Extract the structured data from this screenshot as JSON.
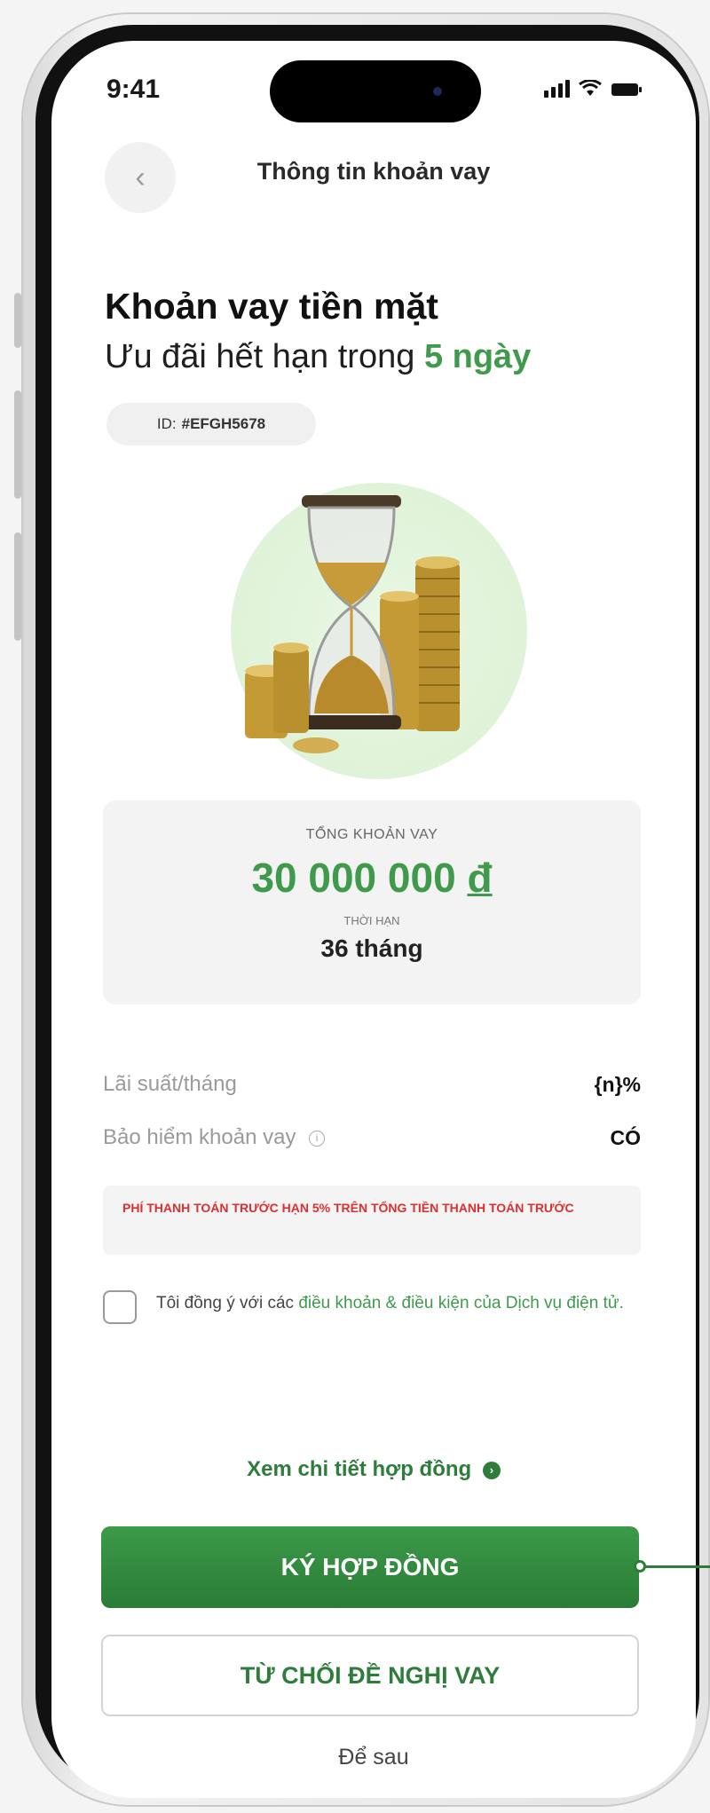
{
  "status_bar": {
    "time": "9:41",
    "icons": [
      "signal-icon",
      "wifi-icon",
      "battery-icon"
    ]
  },
  "header": {
    "back_icon": "chevron-left-icon",
    "title": "Thông tin khoản vay"
  },
  "hero": {
    "title": "Khoản vay tiền mặt",
    "subtitle_prefix": "Ưu đãi hết hạn trong",
    "subtitle_highlight": "5 ngày",
    "id_label": "ID:",
    "id_value": "#EFGH5678",
    "illustration": "hourglass-coins-illustration"
  },
  "loan_summary": {
    "total_label": "TỔNG KHOẢN VAY",
    "total_amount": "30 000 000",
    "currency": "đ",
    "term_label": "THỜI HẠN",
    "term_value": "36 tháng"
  },
  "details": [
    {
      "label": "Lãi suất/tháng",
      "value": "{n}%"
    },
    {
      "label": "Bảo hiểm khoản vay",
      "value": "CÓ",
      "info_icon": "info-circle-icon"
    }
  ],
  "warning": {
    "text": "PHÍ THANH TOÁN TRƯỚC HẠN 5% TRÊN TỔNG TIỀN THANH TOÁN TRƯỚC"
  },
  "consent": {
    "checked": false,
    "text_prefix": "Tôi đồng ý với các",
    "link_text": "điều khoản & điều kiện của Dịch vụ điện tử."
  },
  "actions": {
    "contract_link": "Xem chi tiết hợp đồng",
    "contract_link_icon": "arrow-right-circle-icon",
    "sign_button": "KÝ HỢP ĐỒNG",
    "reject_button": "TỪ CHỐI ĐỀ NGHỊ VAY",
    "later_link": "Để sau"
  },
  "colors": {
    "accent": "#3f9a4b",
    "accent_dark": "#2e7d3a",
    "warning": "#d93030",
    "panel": "#f3f3f3"
  }
}
